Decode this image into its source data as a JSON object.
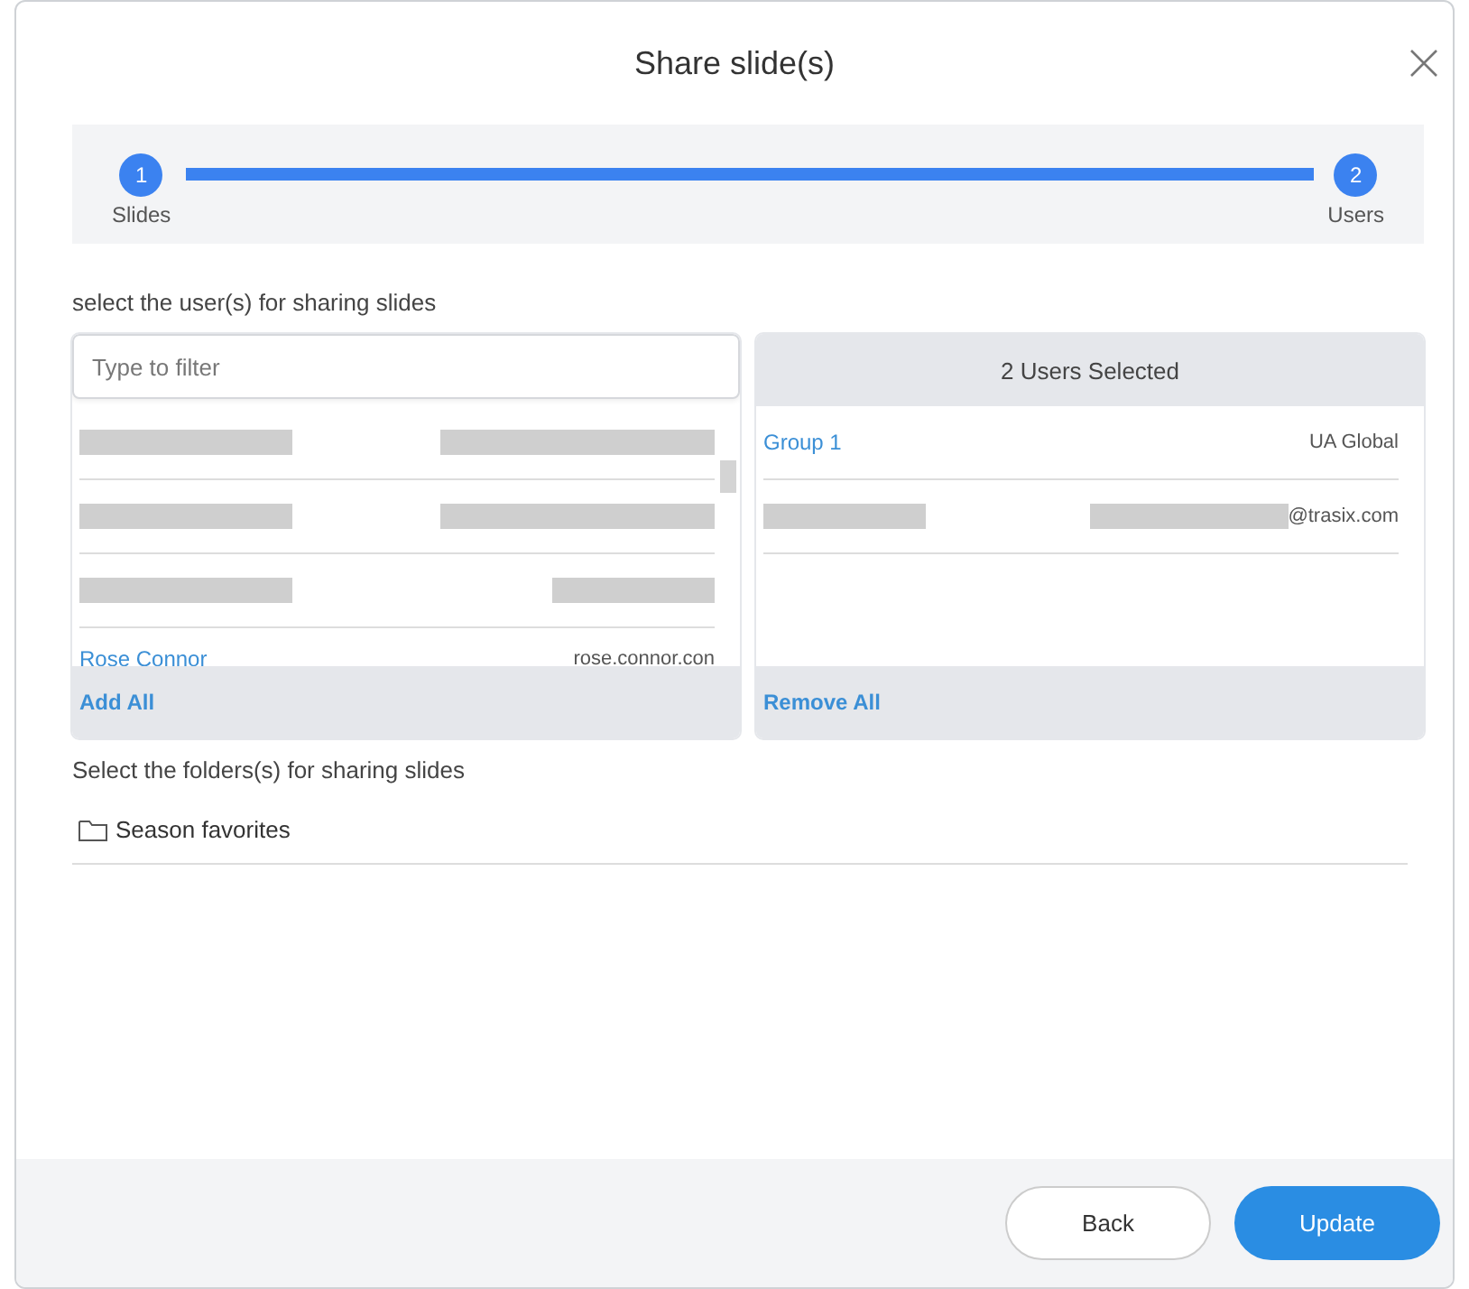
{
  "dialog": {
    "title": "Share slide(s)"
  },
  "steps": [
    {
      "number": "1",
      "label": "Slides"
    },
    {
      "number": "2",
      "label": "Users"
    }
  ],
  "users_prompt": "select the user(s) for sharing slides",
  "available_users": {
    "filter": {
      "placeholder": "Type to filter"
    },
    "rows": [
      {
        "kind": "redacted"
      },
      {
        "kind": "redacted"
      },
      {
        "kind": "redacted"
      },
      {
        "kind": "user",
        "name": "Rose Connor",
        "detail": "rose.connor.con"
      }
    ],
    "footer_action": "Add All"
  },
  "selected_users": {
    "header": "2 Users Selected",
    "rows": [
      {
        "kind": "user",
        "name": "Group 1",
        "detail": "UA Global"
      },
      {
        "kind": "redacted",
        "detail_suffix": "@trasix.com"
      }
    ],
    "footer_action": "Remove All"
  },
  "folders_prompt": "Select the folders(s) for sharing slides",
  "folders": [
    {
      "name": "Season favorites"
    }
  ],
  "buttons": [
    {
      "kind": "secondary",
      "label": "Back"
    },
    {
      "kind": "primary",
      "label": "Update"
    }
  ]
}
